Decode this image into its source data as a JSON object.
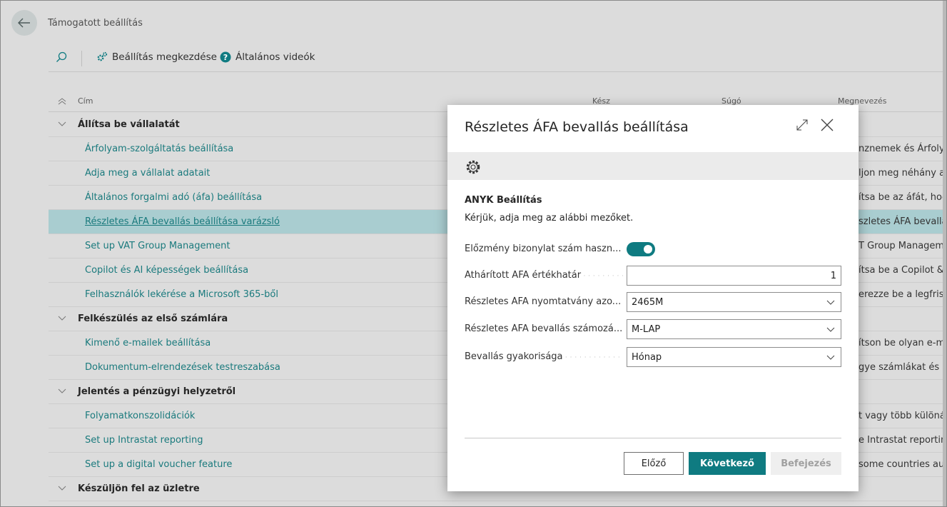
{
  "page": {
    "title": "Támogatott beállítás"
  },
  "toolbar": {
    "setup_label": "Beállítás megkezdése",
    "videos_label": "Általános videók"
  },
  "list": {
    "headers": {
      "title": "Cím",
      "done": "Kész",
      "help": "Súgó",
      "description": "Megnevezés"
    },
    "rows": [
      {
        "kind": "group",
        "label": "Állítsa be vállalatát",
        "desc": ""
      },
      {
        "kind": "item",
        "label": "Árfolyam-szolgáltatás beállítása",
        "desc": "nznemek és Árfolya"
      },
      {
        "kind": "item",
        "label": "Adja meg a vállalat adatait",
        "desc": "ljon meg néhány al"
      },
      {
        "kind": "item",
        "label": "Általános forgalmi adó (áfa) beállítása",
        "desc": "ítsa be az áfát, hog"
      },
      {
        "kind": "item",
        "label": "Részletes ÁFA bevallás beállítása varázsló",
        "desc": "szletes ÁFA bevallá",
        "selected": true
      },
      {
        "kind": "item",
        "label": "Set up VAT Group Management",
        "desc": "T Group Managem"
      },
      {
        "kind": "item",
        "label": "Copilot és AI képességek beállítása",
        "desc": "ítsa be a Copilot &"
      },
      {
        "kind": "item",
        "label": "Felhasználók lekérése a Microsoft 365-ből",
        "desc": "erezze be a legfriss"
      },
      {
        "kind": "group",
        "label": "Felkészülés az első számlára",
        "desc": ""
      },
      {
        "kind": "item",
        "label": "Kimenő e-mailek beállítása",
        "desc": "ítson be olyan e-m"
      },
      {
        "kind": "item",
        "label": "Dokumentum-elrendezések testreszabása",
        "desc": "gye számlákat és eg"
      },
      {
        "kind": "group",
        "label": "Jelentés a pénzügyi helyzetről",
        "desc": ""
      },
      {
        "kind": "item",
        "label": "Folyamatkonszolidációk",
        "desc": "t vagy több különál"
      },
      {
        "kind": "item",
        "label": "Set up Intrastat reporting",
        "desc": "e Intrastat reporting"
      },
      {
        "kind": "item",
        "label": "Set up a digital voucher feature",
        "desc": "some countries aut"
      },
      {
        "kind": "group",
        "label": "Készüljön fel az üzletre",
        "desc": ""
      }
    ]
  },
  "dialog": {
    "title": "Részletes ÁFA bevallás beállítása",
    "section_title": "ANYK Beállítás",
    "section_desc": "Kérjük, adja meg az alábbi mezőket.",
    "fields": {
      "prev_doc_label": "Előzmény bizonylat szám haszn...",
      "prev_doc_value": "on",
      "threshold_label": "Áthárított ÁFA értékhatár",
      "threshold_value": "1",
      "form_id_label": "Részletes ÁFA nyomtatvány azo...",
      "form_id_value": "2465M",
      "numbering_label": "Részletes ÁFA bevallás számozá...",
      "numbering_value": "M-LAP",
      "frequency_label": "Bevallás gyakorisága",
      "frequency_value": "Hónap"
    },
    "buttons": {
      "prev": "Előző",
      "next": "Következő",
      "finish": "Befejezés"
    }
  },
  "colors": {
    "accent": "#0f7b81",
    "link": "#1a7a7d",
    "selected_row": "#a9cdd0",
    "backdrop": "#dcdcdc"
  }
}
